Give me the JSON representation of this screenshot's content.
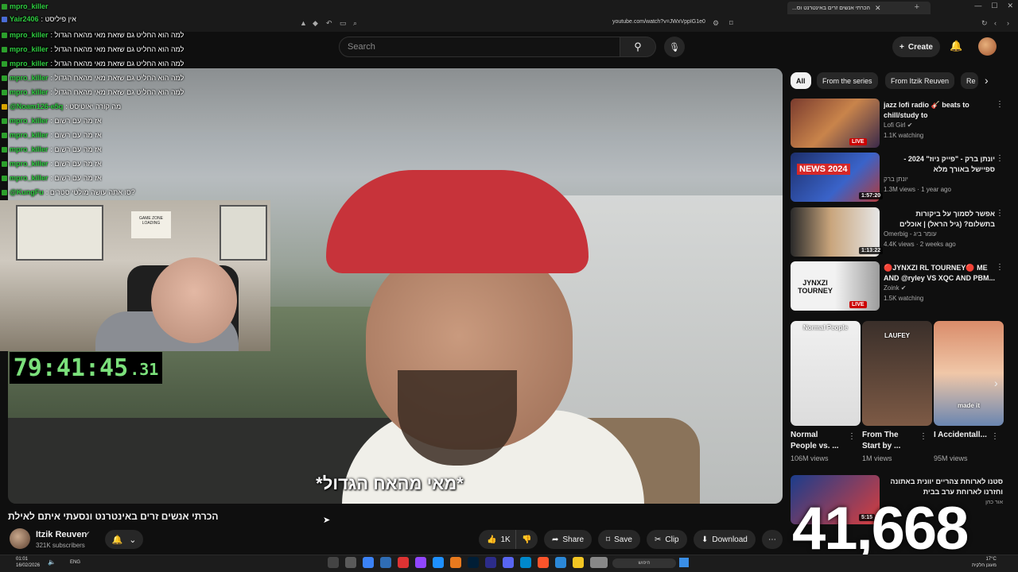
{
  "browser": {
    "tab_title": "הכרתי אנשים זרים באינטרנט וס...",
    "url": "youtube.com/watch?v=JWxVppIG1e0"
  },
  "header": {
    "search_placeholder": "Search",
    "create_label": "Create"
  },
  "video": {
    "subtitle": "*מאי מהאח הגדול*",
    "title": "הכרתי אנשים זרים באינטרנט ונסעתי איתם לאילת"
  },
  "overlay": {
    "timer_main": "79:41:45",
    "timer_frac": ".31",
    "counter": "41,668",
    "webcam_sign": "GAME ZONE",
    "webcam_sign_sub": "LOADING",
    "chat": [
      {
        "user": "mpro_killer",
        "msg": "",
        "badge": "b"
      },
      {
        "user": "Yair2406",
        "msg": ": אין פיליסט",
        "badge": "b2"
      },
      {
        "user": "mpro_killer",
        "msg": ": למה הוא החליט גם שזאת מאי מהאח הגדול",
        "badge": "b"
      },
      {
        "user": "mpro_killer",
        "msg": ": למה הוא החליט גם שזאת מאי מהאח הגדול",
        "badge": "b"
      },
      {
        "user": "mpro_killer",
        "msg": ": למה הוא החליט גם שזאת מאי מהאח הגדול",
        "badge": "b"
      },
      {
        "user": "mpro_killer",
        "msg": ": למה הוא החליט גם שזאת מאי מהאח הגדול",
        "badge": "b"
      },
      {
        "user": "mpro_killer",
        "msg": ": למה הוא החליט גם שזאת מאי מהאח הגדול",
        "badge": "b"
      },
      {
        "user": "@Noam126-e5q",
        "msg": ": מה קורה יאוטיסט",
        "badge": "b3"
      },
      {
        "user": "mpro_killer",
        "msg": ": אז מה עם רשום",
        "badge": "b"
      },
      {
        "user": "mpro_killer",
        "msg": ": אז מה עם רשום",
        "badge": "b"
      },
      {
        "user": "mpro_killer",
        "msg": ": אז מה עם רשום",
        "badge": "b"
      },
      {
        "user": "mpro_killer",
        "msg": ": אז מה עם רשום",
        "badge": "b"
      },
      {
        "user": "mpro_killer",
        "msg": ": אז מה עם רשום",
        "badge": "b"
      },
      {
        "user": "@KungFu",
        "msg": ": סו אתה עושה מולטי סטרים?",
        "badge": "b"
      }
    ]
  },
  "channel": {
    "name": "Itzik Reuven",
    "verified": "✔",
    "subscribers": "321K subscribers"
  },
  "actions": {
    "likes": "1K",
    "share": "Share",
    "save": "Save",
    "clip": "Clip",
    "download": "Download"
  },
  "chips": [
    "All",
    "From the series",
    "From Itzik Reuven",
    "Re"
  ],
  "recommendations": [
    {
      "title": "jazz lofi radio 🎸 beats to chill/study to",
      "channel": "Lofi Girl ✔",
      "meta": "1.1K watching",
      "badge": "LIVE",
      "rtl": false
    },
    {
      "title": "יונתן ברק - \"פייק ניוז\" 2024 - ספיישל באורך מלא",
      "channel": "יונתן ברק",
      "meta": "1.3M views · 1 year ago",
      "badge": "1:57:20",
      "rtl": true
    },
    {
      "title": "אפשר לסמוך על ביקורות בתשלום? (גיל הראל) | אוכלים בגדול",
      "channel": "Omerbig - עומר ביג",
      "meta": "4.4K views · 2 weeks ago",
      "badge": "1:13:22",
      "rtl": true
    },
    {
      "title": "🔴JYNXZI RL TOURNEY🔴 ME AND @ryley VS XQC AND PBM...",
      "channel": "Zoink ✔",
      "meta": "1.5K watching",
      "badge": "LIVE",
      "rtl": false
    }
  ],
  "thumb_texts": {
    "news": "NEWS 2024",
    "jynxzi": "JYNXZI TOURNEY"
  },
  "shorts": [
    {
      "title": "Normal People vs. ...",
      "views": "106M views",
      "caption": "Normal People"
    },
    {
      "title": "From The Start by ...",
      "views": "1M views",
      "caption": "LAUFEY"
    },
    {
      "title": "I Accidentall...",
      "views": "95M views",
      "caption": "made it"
    }
  ],
  "last_rec": {
    "title": "סטנו לארוחת צהריים יוונית באתונה וחזרנו לארוחת ערב בבית",
    "sub": "אור כהן",
    "duration": "5:15"
  },
  "taskbar": {
    "time": "01:01",
    "date": "16/02/2026",
    "lang": "ENG",
    "search": "חיפוש",
    "weather": "17°C",
    "weather_sub": "מעונן חלקית"
  },
  "colors": {
    "bg": "#0f0f0f",
    "chip_active": "#f1f1f1",
    "live": "#cc0000",
    "chat_user": "#2ecc40",
    "timer": "#7be07b"
  }
}
